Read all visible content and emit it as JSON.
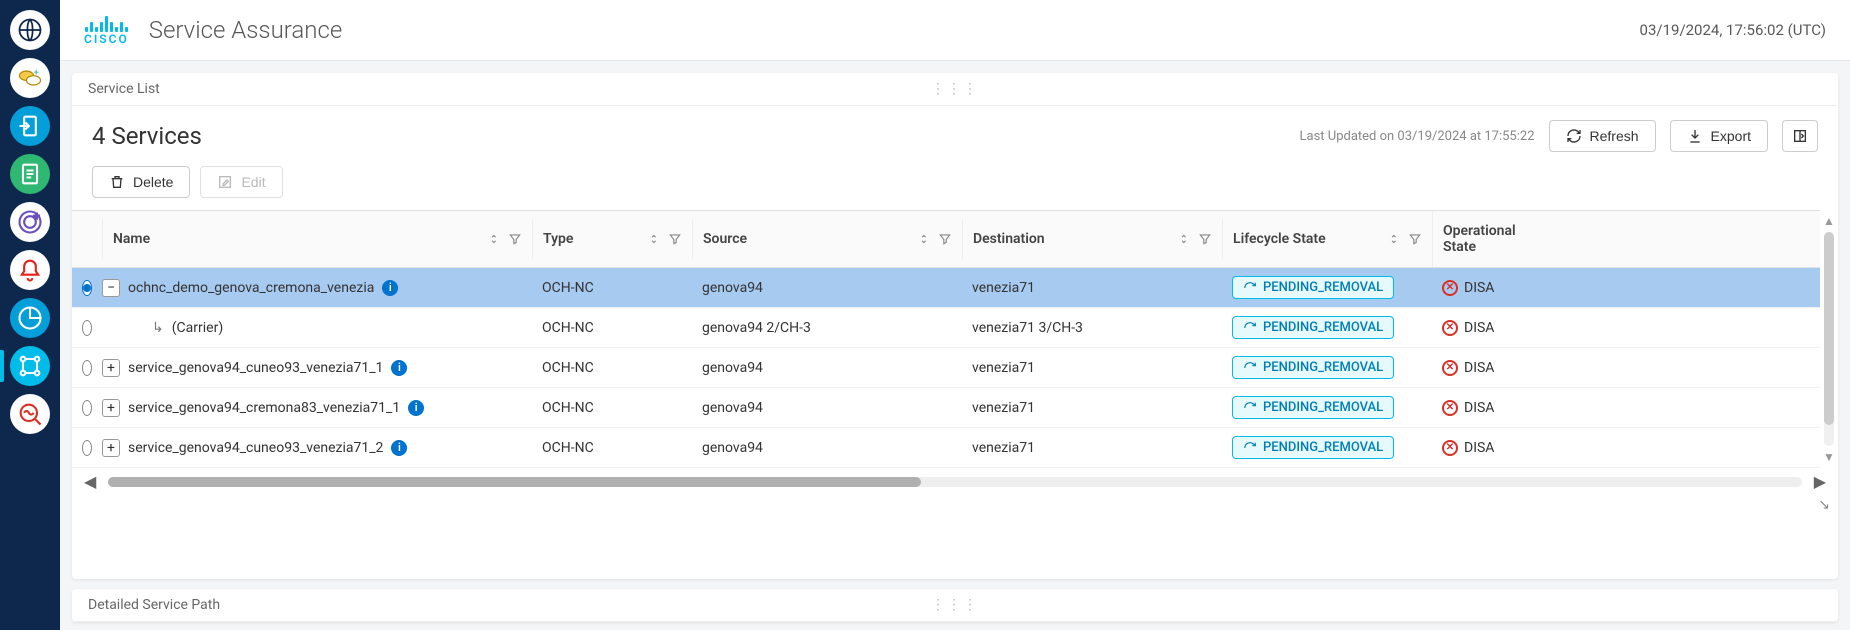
{
  "header": {
    "brand": "CISCO",
    "title": "Service Assurance",
    "timestamp": "03/19/2024, 17:56:02 (UTC)"
  },
  "sidebar": {
    "items": [
      {
        "icon": "globe"
      },
      {
        "icon": "pills"
      },
      {
        "icon": "auth"
      },
      {
        "icon": "doc"
      },
      {
        "icon": "layers"
      },
      {
        "icon": "alarm"
      },
      {
        "icon": "chart"
      },
      {
        "icon": "topology",
        "active": true
      },
      {
        "icon": "inspect"
      }
    ]
  },
  "serviceList": {
    "panelTitle": "Service List",
    "countLabel": "4 Services",
    "lastUpdated": "Last Updated on 03/19/2024 at 17:55:22",
    "buttons": {
      "refresh": "Refresh",
      "export": "Export",
      "delete": "Delete",
      "edit": "Edit"
    },
    "columns": {
      "name": "Name",
      "type": "Type",
      "source": "Source",
      "destination": "Destination",
      "lifecycle": "Lifecycle State",
      "operational": "Operational State"
    },
    "rows": [
      {
        "selected": true,
        "expandState": "minus",
        "name": "ochnc_demo_genova_cremona_venezia",
        "info": true,
        "type": "OCH-NC",
        "source": "genova94",
        "destination": "venezia71",
        "lifecycle": "PENDING_REMOVAL",
        "opState": "DISA"
      },
      {
        "selected": false,
        "expandState": "child",
        "name": "(Carrier)",
        "info": false,
        "type": "OCH-NC",
        "source": "genova94 2/CH-3",
        "destination": "venezia71 3/CH-3",
        "lifecycle": "PENDING_REMOVAL",
        "opState": "DISA"
      },
      {
        "selected": false,
        "expandState": "plus",
        "name": "service_genova94_cuneo93_venezia71_1",
        "info": true,
        "type": "OCH-NC",
        "source": "genova94",
        "destination": "venezia71",
        "lifecycle": "PENDING_REMOVAL",
        "opState": "DISA"
      },
      {
        "selected": false,
        "expandState": "plus",
        "name": "service_genova94_cremona83_venezia71_1",
        "info": true,
        "type": "OCH-NC",
        "source": "genova94",
        "destination": "venezia71",
        "lifecycle": "PENDING_REMOVAL",
        "opState": "DISA"
      },
      {
        "selected": false,
        "expandState": "plus",
        "name": "service_genova94_cuneo93_venezia71_2",
        "info": true,
        "type": "OCH-NC",
        "source": "genova94",
        "destination": "venezia71",
        "lifecycle": "PENDING_REMOVAL",
        "opState": "DISA"
      }
    ]
  },
  "detailPanel": {
    "title": "Detailed Service Path"
  }
}
